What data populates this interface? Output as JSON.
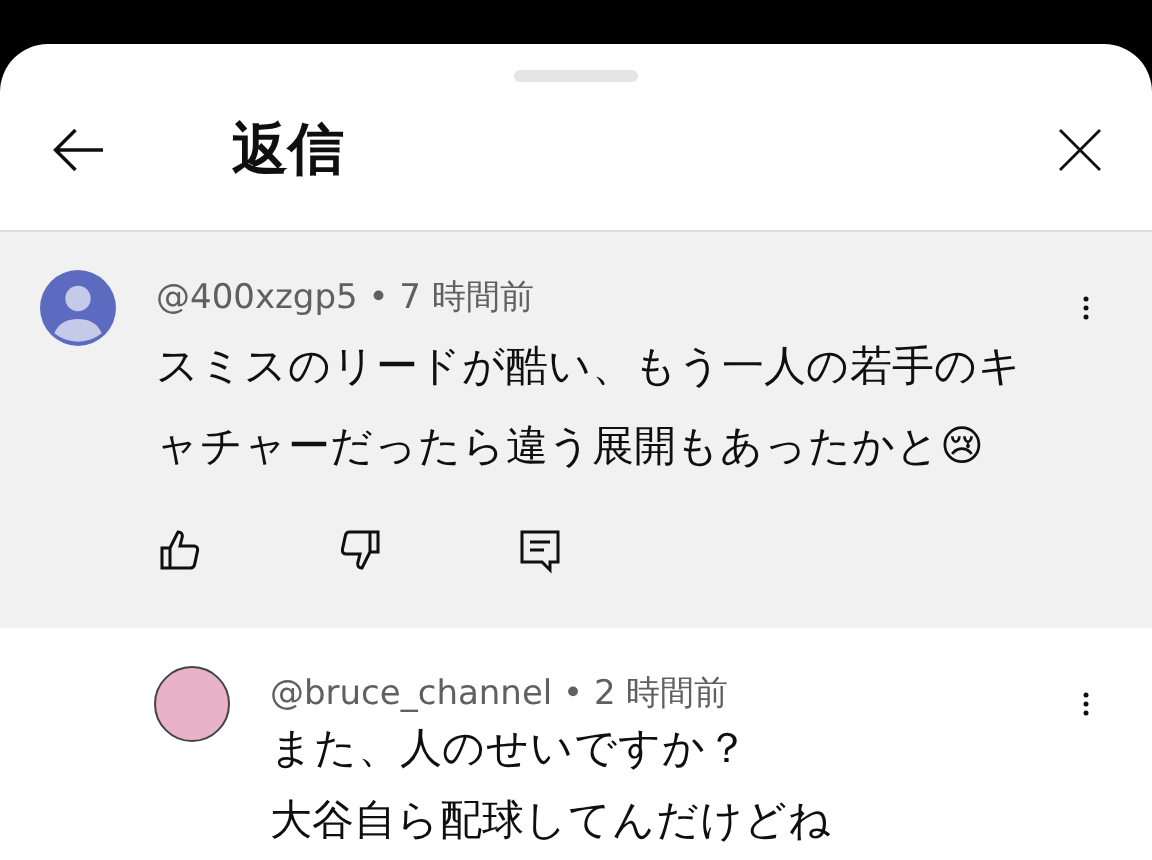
{
  "header": {
    "title": "返信"
  },
  "comments": [
    {
      "kind": "parent",
      "meta": "@400xzgp5 • 7 時間前",
      "text": "スミスのリードが酷い、もう一人の若手のキャチャーだったら違う展開もあったかと😢"
    },
    {
      "kind": "reply",
      "meta": "@bruce_channel • 2 時間前",
      "lines": [
        "また、人のせいですか？",
        "大谷自ら配球してんだけどね"
      ]
    }
  ]
}
